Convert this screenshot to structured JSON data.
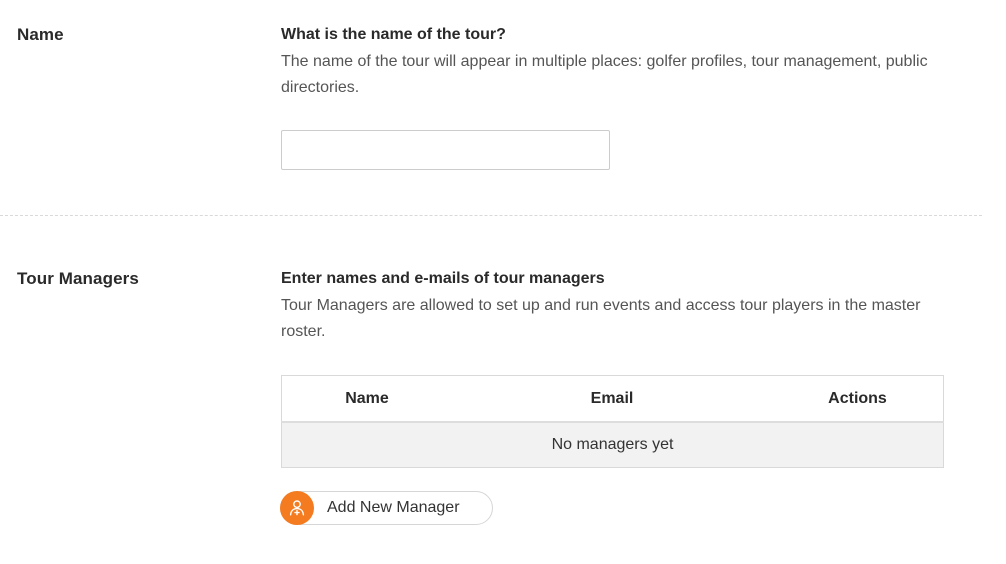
{
  "colors": {
    "accent": "#f47b20",
    "divider": "#d9d9d9",
    "table_empty_bg": "#f2f2f2"
  },
  "name_section": {
    "label": "Name",
    "question": "What is the name of the tour?",
    "help": "The name of the tour will appear in multiple places: golfer profiles, tour management, public directories.",
    "input_value": "",
    "input_placeholder": ""
  },
  "managers_section": {
    "label": "Tour Managers",
    "question": "Enter names and e-mails of tour managers",
    "help": "Tour Managers are allowed to set up and run events and access tour players in the master roster.",
    "table": {
      "columns": [
        "Name",
        "Email",
        "Actions"
      ],
      "empty_message": "No managers yet"
    },
    "add_button_label": "Add New Manager",
    "add_button_icon": "add-user-icon"
  }
}
